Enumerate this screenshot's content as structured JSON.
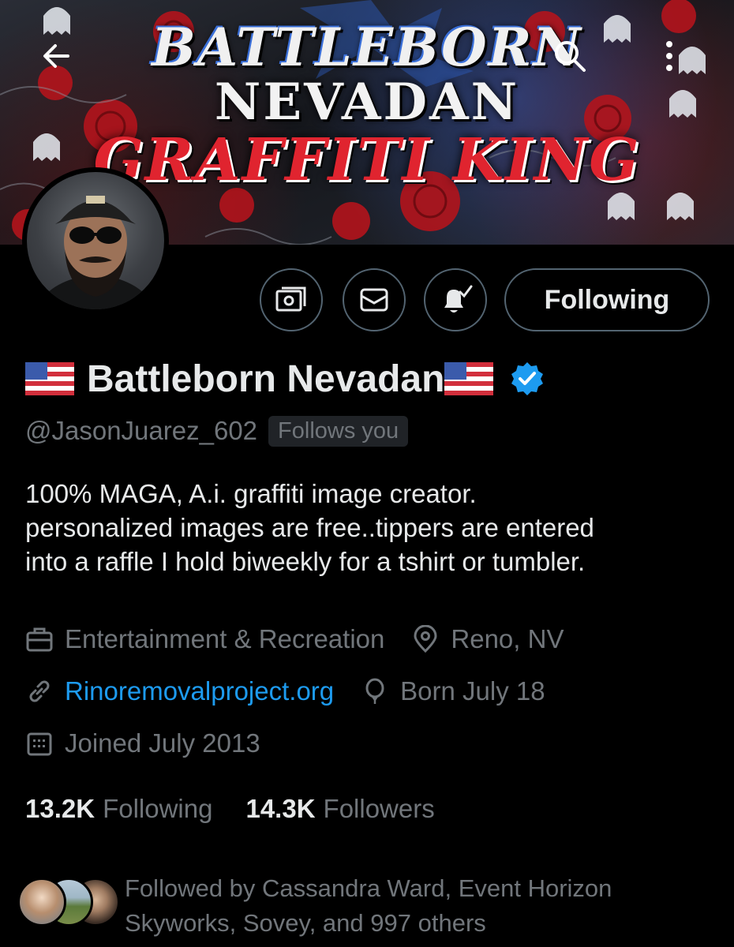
{
  "banner": {
    "line1": "BATTLEBORN",
    "line2": "NEVADAN",
    "line3": "GRAFFITI KING"
  },
  "profile": {
    "display_name": "Battleborn Nevadan",
    "handle": "@JasonJuarez_602",
    "follows_you": "Follows you",
    "verified": true,
    "bio_lines": [
      "100% MAGA, A.i. graffiti image creator.",
      "personalized images are free..tippers are entered",
      "into a raffle I hold biweekly for a tshirt or tumbler."
    ],
    "category": "Entertainment & Recreation",
    "location": "Reno, NV",
    "website": "Rinoremovalproject.org",
    "birthday": "Born July 18",
    "joined": "Joined July 2013"
  },
  "actions": {
    "follow_label": "Following"
  },
  "stats": {
    "following_count": "13.2K",
    "following_label": "Following",
    "followers_count": "14.3K",
    "followers_label": "Followers"
  },
  "followed_by": {
    "line1": "Followed by Cassandra Ward, Event Horizon",
    "line2": "Skyworks, Sovey, and 997 others"
  },
  "colors": {
    "background": "#000000",
    "text_primary": "#e7e9ea",
    "text_secondary": "#71767b",
    "link": "#1d9bf0",
    "verified": "#1d9bf0",
    "border": "#536471"
  },
  "icons": {
    "back": "arrow-left-icon",
    "search": "search-icon",
    "more": "more-vertical-icon",
    "tip": "money-icon",
    "message": "envelope-icon",
    "notifications": "bell-check-icon",
    "category": "briefcase-icon",
    "location": "location-pin-icon",
    "website": "link-icon",
    "birthday": "balloon-icon",
    "joined": "calendar-icon"
  }
}
